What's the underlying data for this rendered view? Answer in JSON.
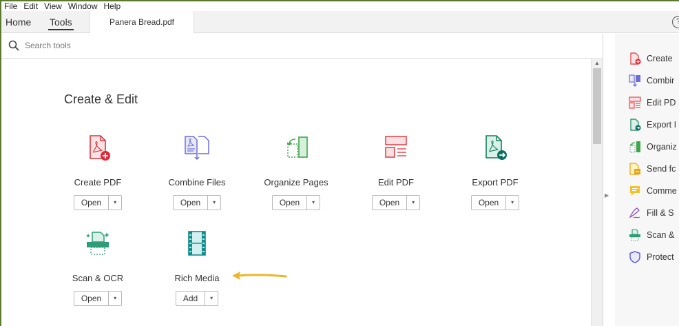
{
  "menu": {
    "items": [
      "File",
      "Edit",
      "View",
      "Window",
      "Help"
    ]
  },
  "tabs": {
    "home": "Home",
    "tools": "Tools",
    "document": "Panera Bread.pdf",
    "help_symbol": "?"
  },
  "search": {
    "placeholder": "Search tools"
  },
  "section": {
    "title": "Create & Edit"
  },
  "tools": [
    {
      "label": "Create PDF",
      "button": "Open",
      "icon": "create-pdf-icon",
      "color": "#d7373f"
    },
    {
      "label": "Combine Files",
      "button": "Open",
      "icon": "combine-files-icon",
      "color": "#6e6ed8"
    },
    {
      "label": "Organize Pages",
      "button": "Open",
      "icon": "organize-pages-icon",
      "color": "#3da74e"
    },
    {
      "label": "Edit PDF",
      "button": "Open",
      "icon": "edit-pdf-icon",
      "color": "#e34850"
    },
    {
      "label": "Export PDF",
      "button": "Open",
      "icon": "export-pdf-icon",
      "color": "#12805c"
    },
    {
      "label": "Scan & OCR",
      "button": "Open",
      "icon": "scan-ocr-icon",
      "color": "#2d9d78"
    },
    {
      "label": "Rich Media",
      "button": "Add",
      "icon": "rich-media-icon",
      "color": "#0f8c8c"
    }
  ],
  "dropdown_symbol": "▾",
  "right_panel": {
    "items": [
      {
        "label": "Create",
        "icon": "create-pdf-icon"
      },
      {
        "label": "Combir",
        "icon": "combine-files-icon"
      },
      {
        "label": "Edit PD",
        "icon": "edit-pdf-icon"
      },
      {
        "label": "Export I",
        "icon": "export-pdf-icon"
      },
      {
        "label": "Organiz",
        "icon": "organize-pages-icon"
      },
      {
        "label": "Send fc",
        "icon": "send-for-review-icon"
      },
      {
        "label": "Comme",
        "icon": "comment-icon"
      },
      {
        "label": "Fill & S",
        "icon": "fill-sign-icon"
      },
      {
        "label": "Scan &",
        "icon": "scan-ocr-icon"
      },
      {
        "label": "Protect",
        "icon": "protect-icon"
      }
    ]
  },
  "annotation": {
    "arrow_color": "#f0b429"
  }
}
